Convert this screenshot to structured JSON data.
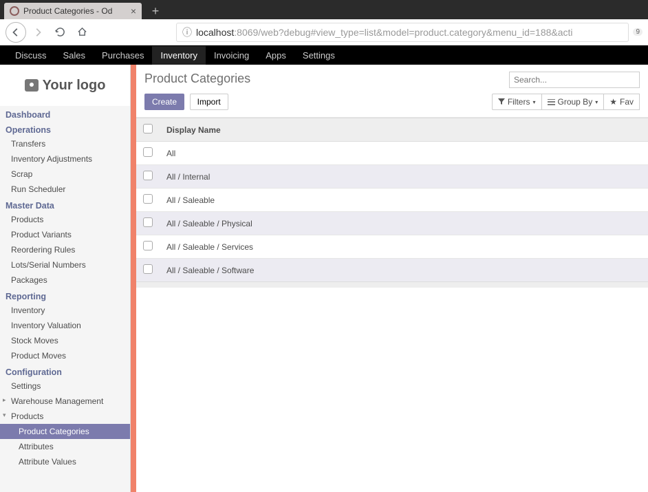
{
  "browser": {
    "tab_title": "Product Categories - Od",
    "url_host": "localhost",
    "url_rest": ":8069/web?debug#view_type=list&model=product.category&menu_id=188&acti",
    "url_badge": "9"
  },
  "topmenu": [
    "Discuss",
    "Sales",
    "Purchases",
    "Inventory",
    "Invoicing",
    "Apps",
    "Settings"
  ],
  "topmenu_active": "Inventory",
  "logo": "Your logo",
  "sidebar": {
    "sections": [
      {
        "title": "Dashboard",
        "items": []
      },
      {
        "title": "Operations",
        "items": [
          "Transfers",
          "Inventory Adjustments",
          "Scrap",
          "Run Scheduler"
        ]
      },
      {
        "title": "Master Data",
        "items": [
          "Products",
          "Product Variants",
          "Reordering Rules",
          "Lots/Serial Numbers",
          "Packages"
        ]
      },
      {
        "title": "Reporting",
        "items": [
          "Inventory",
          "Inventory Valuation",
          "Stock Moves",
          "Product Moves"
        ]
      },
      {
        "title": "Configuration",
        "items": [
          "Settings"
        ],
        "extra": [
          {
            "label": "Warehouse Management",
            "caret": "▸"
          },
          {
            "label": "Products",
            "caret": "▾",
            "children": [
              "Product Categories",
              "Attributes",
              "Attribute Values"
            ],
            "active_child": "Product Categories"
          }
        ]
      }
    ]
  },
  "main": {
    "title": "Product Categories",
    "search_placeholder": "Search...",
    "create": "Create",
    "import": "Import",
    "filters": "Filters",
    "groupby": "Group By",
    "favorites": "Fav",
    "column": "Display Name",
    "rows": [
      "All",
      "All / Internal",
      "All / Saleable",
      "All / Saleable / Physical",
      "All / Saleable / Services",
      "All / Saleable / Software"
    ]
  }
}
